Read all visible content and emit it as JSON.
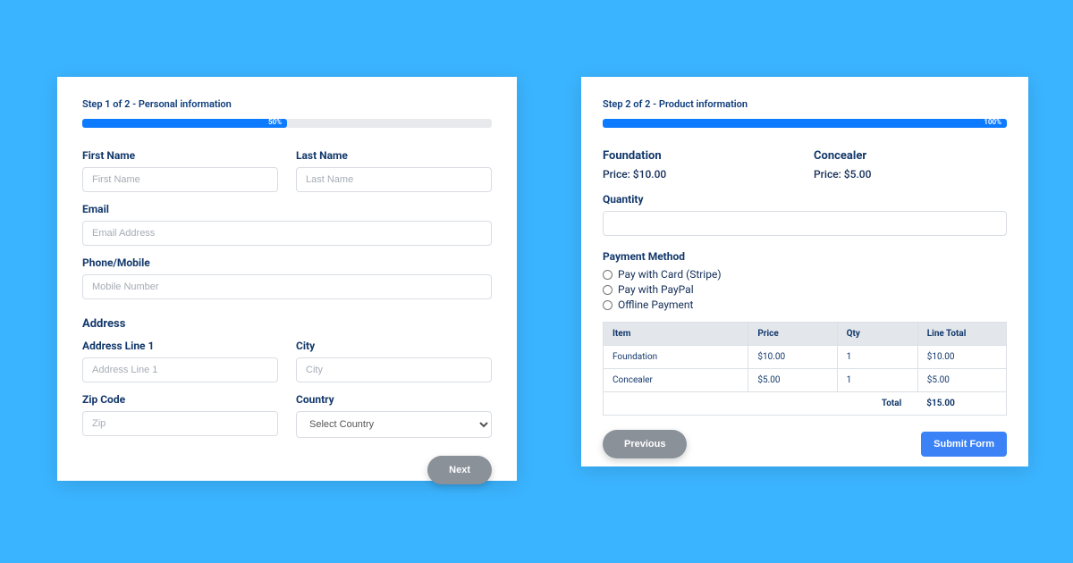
{
  "left": {
    "step_title": "Step 1 of 2 - Personal information",
    "progress_pct": 50,
    "progress_label": "50%",
    "first_name": {
      "label": "First Name",
      "placeholder": "First Name"
    },
    "last_name": {
      "label": "Last Name",
      "placeholder": "Last Name"
    },
    "email": {
      "label": "Email",
      "placeholder": "Email Address"
    },
    "phone": {
      "label": "Phone/Mobile",
      "placeholder": "Mobile Number"
    },
    "address_section": "Address",
    "addr1": {
      "label": "Address Line 1",
      "placeholder": "Address Line 1"
    },
    "city": {
      "label": "City",
      "placeholder": "City"
    },
    "zip": {
      "label": "Zip Code",
      "placeholder": "Zip"
    },
    "country": {
      "label": "Country",
      "placeholder": "Select Country"
    },
    "next_btn": "Next"
  },
  "right": {
    "step_title": "Step 2 of 2 - Product information",
    "progress_pct": 100,
    "progress_label": "100%",
    "product_a": {
      "name": "Foundation",
      "price_line": "Price: $10.00"
    },
    "product_b": {
      "name": "Concealer",
      "price_line": "Price: $5.00"
    },
    "quantity_label": "Quantity",
    "payment_label": "Payment Method",
    "payment_options": {
      "stripe": "Pay with Card (Stripe)",
      "paypal": "Pay with PayPal",
      "offline": "Offline Payment"
    },
    "table": {
      "headers": {
        "item": "Item",
        "price": "Price",
        "qty": "Qty",
        "line_total": "Line Total"
      },
      "rows": [
        {
          "item": "Foundation",
          "price": "$10.00",
          "qty": "1",
          "line_total": "$10.00"
        },
        {
          "item": "Concealer",
          "price": "$5.00",
          "qty": "1",
          "line_total": "$5.00"
        }
      ],
      "total_label": "Total",
      "total_value": "$15.00"
    },
    "previous_btn": "Previous",
    "submit_btn": "Submit Form"
  }
}
